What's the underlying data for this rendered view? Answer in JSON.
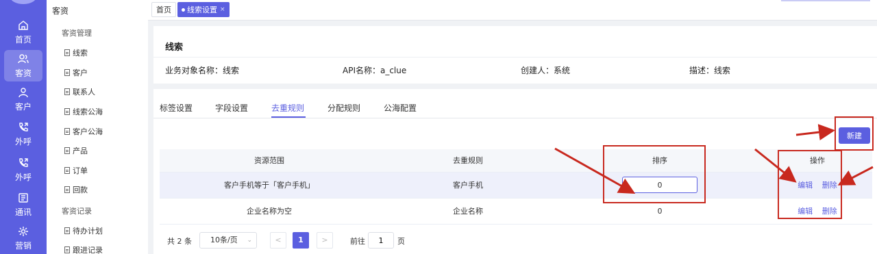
{
  "rail": {
    "items": [
      {
        "label": "首页",
        "icon": "home-icon"
      },
      {
        "label": "客资",
        "icon": "users-icon"
      },
      {
        "label": "客户",
        "icon": "user-icon"
      },
      {
        "label": "外呼",
        "icon": "phone-out-icon"
      },
      {
        "label": "外呼",
        "icon": "phone-out-icon"
      },
      {
        "label": "通讯",
        "icon": "contacts-icon"
      },
      {
        "label": "营销",
        "icon": "marketing-icon"
      }
    ],
    "active": "客资",
    "accent": "#5b5fe0"
  },
  "menu": {
    "title": "客资",
    "groups": [
      {
        "label": "客资管理",
        "items": [
          "线索",
          "客户",
          "联系人",
          "线索公海",
          "客户公海",
          "产品",
          "订单",
          "回款"
        ]
      },
      {
        "label": "客资记录",
        "items": [
          "待办计划",
          "跟进记录"
        ]
      }
    ]
  },
  "tabs": {
    "home": "首页",
    "current": "线索设置",
    "close": "×"
  },
  "info": {
    "title": "线索",
    "object_name": "业务对象名称：线索",
    "api_name": "API名称：a_clue",
    "creator": "创建人：系统",
    "description": "描述：线索"
  },
  "subtabs": [
    "标签设置",
    "字段设置",
    "去重规则",
    "分配规则",
    "公海配置"
  ],
  "active_subtab": "去重规则",
  "new_button": "新建",
  "table": {
    "headers": [
      "资源范围",
      "去重规则",
      "排序",
      "操作"
    ],
    "rows": [
      {
        "scope": "客户手机等于「客户手机」",
        "rule": "客户手机",
        "order": "0",
        "edit": "编辑",
        "delete": "删除"
      },
      {
        "scope": "企业名称为空",
        "rule": "企业名称",
        "order": "0",
        "edit": "编辑",
        "delete": "删除"
      }
    ]
  },
  "pagination": {
    "total": "共 2 条",
    "page_size": "10条/页",
    "prev": "<",
    "current_page": "1",
    "next": ">",
    "goto_label": "前往",
    "goto_value": "1",
    "page_suffix": "页"
  },
  "annotation_color": "#c8281e"
}
